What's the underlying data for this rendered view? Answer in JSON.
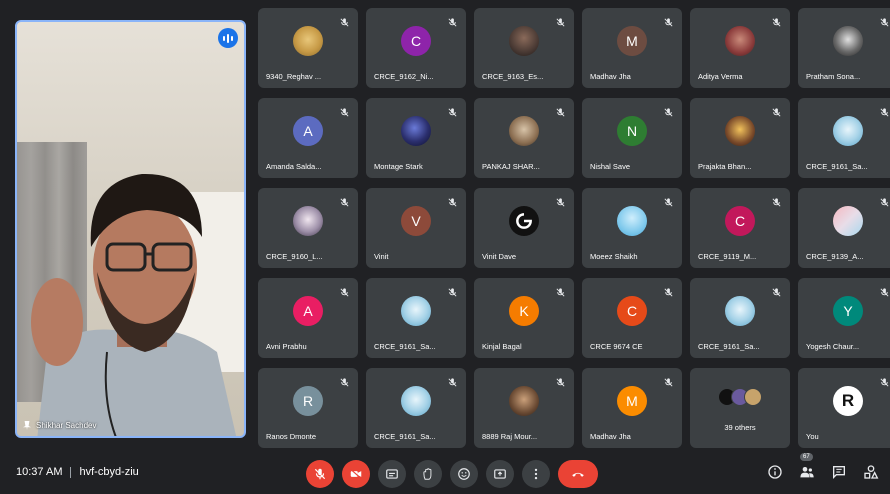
{
  "speaker": {
    "name": "Shikhar Sachdev"
  },
  "participants": [
    {
      "name": "9340_Reghav ...",
      "avatar": "photo-doge",
      "letter": ""
    },
    {
      "name": "CRCE_9162_Ni...",
      "avatar": "#8e24aa",
      "letter": "C"
    },
    {
      "name": "CRCE_9163_Es...",
      "avatar": "photo-dark",
      "letter": ""
    },
    {
      "name": "Madhav Jha",
      "avatar": "#6d4c41",
      "letter": "M"
    },
    {
      "name": "Aditya Verma",
      "avatar": "photo-aditya",
      "letter": ""
    },
    {
      "name": "Pratham Sona...",
      "avatar": "photo-bw",
      "letter": ""
    },
    {
      "name": "Amanda Salda...",
      "avatar": "#5c6bc0",
      "letter": "A"
    },
    {
      "name": "Montage Stark",
      "avatar": "photo-galaxy",
      "letter": ""
    },
    {
      "name": "PANKAJ SHAR...",
      "avatar": "photo-pankaj",
      "letter": ""
    },
    {
      "name": "Nishal Save",
      "avatar": "#2e7d32",
      "letter": "N"
    },
    {
      "name": "Prajakta Bhan...",
      "avatar": "photo-prajakta",
      "letter": ""
    },
    {
      "name": "CRCE_9161_Sa...",
      "avatar": "photo-blue",
      "letter": ""
    },
    {
      "name": "CRCE_9160_L...",
      "avatar": "photo-anime",
      "letter": ""
    },
    {
      "name": "Vinit",
      "avatar": "#8d4a3a",
      "letter": "V"
    },
    {
      "name": "Vinit Dave",
      "avatar": "photo-g",
      "letter": ""
    },
    {
      "name": "Moeez Shaikh",
      "avatar": "photo-moeez",
      "letter": ""
    },
    {
      "name": "CRCE_9119_M...",
      "avatar": "#c2185b",
      "letter": "C"
    },
    {
      "name": "CRCE_9139_A...",
      "avatar": "photo-pinkblue",
      "letter": ""
    },
    {
      "name": "Avni Prabhu",
      "avatar": "#e91e63",
      "letter": "A"
    },
    {
      "name": "CRCE_9161_Sa...",
      "avatar": "photo-blue",
      "letter": ""
    },
    {
      "name": "Kinjal Bagal",
      "avatar": "#f57c00",
      "letter": "K"
    },
    {
      "name": "CRCE 9674 CE",
      "avatar": "#e64a19",
      "letter": "C"
    },
    {
      "name": "CRCE_9161_Sa...",
      "avatar": "photo-blue",
      "letter": ""
    },
    {
      "name": "Yogesh Chaur...",
      "avatar": "#00897b",
      "letter": "Y"
    },
    {
      "name": "Ranos Dmonte",
      "avatar": "#78909c",
      "letter": "R"
    },
    {
      "name": "CRCE_9161_Sa...",
      "avatar": "photo-blue",
      "letter": ""
    },
    {
      "name": "8889 Raj Mour...",
      "avatar": "photo-raj",
      "letter": ""
    },
    {
      "name": "Madhav Jha",
      "avatar": "#fb8c00",
      "letter": "M"
    }
  ],
  "others_tile": {
    "label": "39 others"
  },
  "you_tile": {
    "name": "You",
    "letter": "R"
  },
  "bottom": {
    "time": "10:37 AM",
    "meeting_code": "hvf-cbyd-ziu",
    "participants_count": "67"
  },
  "colors": {
    "accent": "#8ab4f8",
    "danger": "#ea4335",
    "tile": "#3c4043",
    "background": "#202124"
  }
}
